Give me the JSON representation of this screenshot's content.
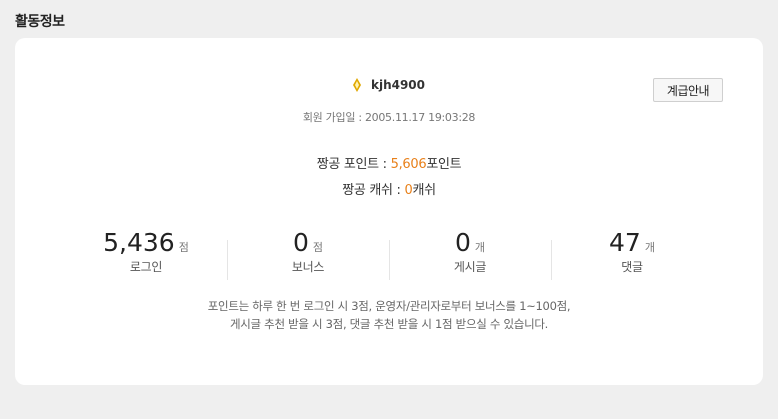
{
  "section": {
    "title": "활동정보"
  },
  "user": {
    "icon": "diamond-rank-icon",
    "username": "kjh4900",
    "grade_button_label": "계급안내",
    "join_label": "회원 가입일 : ",
    "join_date": "2005.11.17 19:03:28"
  },
  "points": {
    "label": "짱공 포인트 : ",
    "value": "5,606",
    "unit": "포인트"
  },
  "cash": {
    "label": "짱공 캐쉬 : ",
    "value": "0",
    "unit": "캐쉬"
  },
  "stats": [
    {
      "value": "5,436",
      "unit": "점",
      "label": "로그인"
    },
    {
      "value": "0",
      "unit": "점",
      "label": "보너스"
    },
    {
      "value": "0",
      "unit": "개",
      "label": "게시글"
    },
    {
      "value": "47",
      "unit": "개",
      "label": "댓글"
    }
  ],
  "note": {
    "line1": "포인트는 하루 한 번 로그인 시 3점, 운영자/관리자로부터 보너스를 1~100점,",
    "line2": "게시글 추천 받을 시 3점, 댓글 추천 받을 시 1점 받으실 수 있습니다."
  },
  "colors": {
    "accent": "#e8801a",
    "background": "#efefef",
    "card": "#ffffff",
    "rank_icon": "#e0a800"
  }
}
